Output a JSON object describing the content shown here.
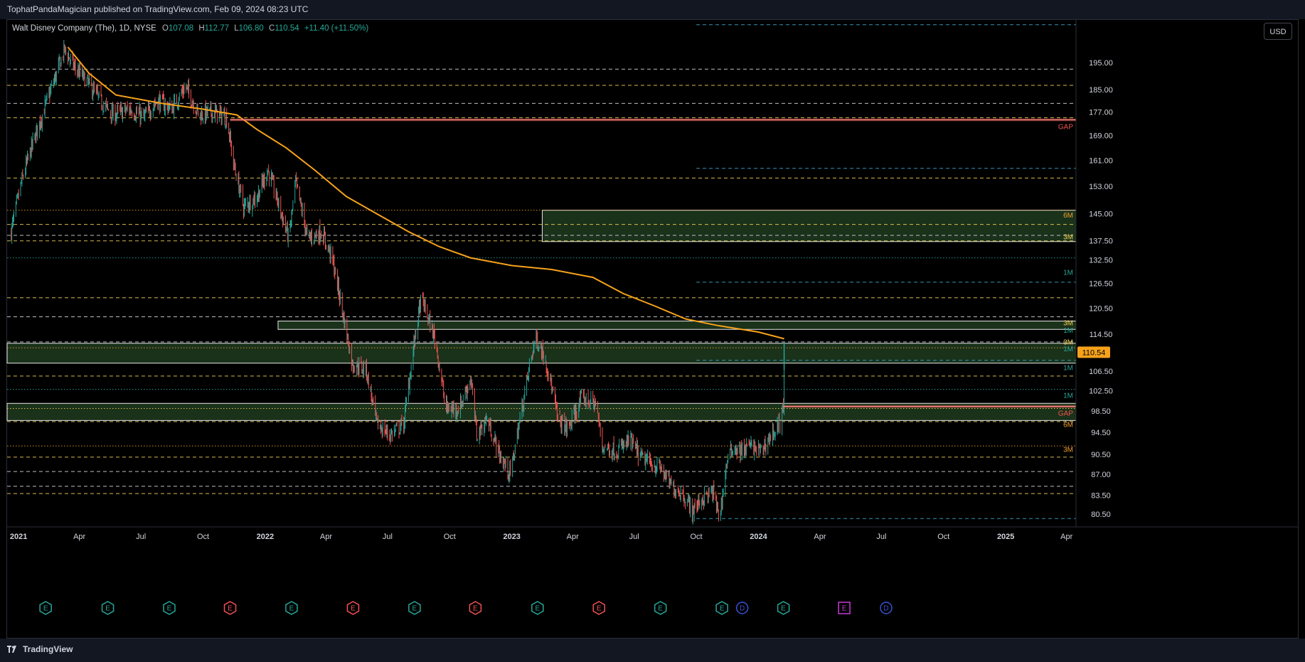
{
  "header": {
    "published": "TophatPandaMagician published on TradingView.com, Feb 09, 2024 08:23 UTC"
  },
  "legend": {
    "symbol": "Walt Disney Company (The), 1D, NYSE",
    "o_label": "O",
    "o_val": "107.08",
    "h_label": "H",
    "h_val": "112.77",
    "l_label": "L",
    "l_val": "106.80",
    "c_label": "C",
    "c_val": "110.54",
    "change": "+11.40 (+11.50%)"
  },
  "currency_button": "USD",
  "footer": {
    "brand": "TradingView"
  },
  "colors": {
    "up": "#26a69a",
    "down": "#ef5350",
    "ma": "#f7a21b",
    "yellow_line": "#f0d050",
    "orange_line": "#f0a030",
    "teal_line": "#26a69a",
    "cyan_line": "#3aa6c8",
    "white_line": "#d1d4dc",
    "red_line": "#ef5350",
    "zone_fill": "#1e3a1e",
    "price_badge": "#f7a21b"
  },
  "chart_data": {
    "type": "candlestick",
    "title": "",
    "y_scale": "log",
    "ylim": [
      78.5,
      212
    ],
    "x_range": [
      "2020-12-15",
      "2025-04-15"
    ],
    "y_ticks": [
      "195.00",
      "185.00",
      "177.00",
      "169.00",
      "161.00",
      "153.00",
      "145.00",
      "137.50",
      "132.50",
      "126.50",
      "120.50",
      "114.50",
      "110.54",
      "106.50",
      "102.50",
      "98.50",
      "94.50",
      "90.50",
      "87.00",
      "83.50",
      "80.50"
    ],
    "x_ticks": [
      {
        "label": "2021",
        "date": "2021-01-01",
        "bold": true
      },
      {
        "label": "Apr",
        "date": "2021-04-01"
      },
      {
        "label": "Jul",
        "date": "2021-07-01"
      },
      {
        "label": "Oct",
        "date": "2021-10-01"
      },
      {
        "label": "2022",
        "date": "2022-01-01",
        "bold": true
      },
      {
        "label": "Apr",
        "date": "2022-04-01"
      },
      {
        "label": "Jul",
        "date": "2022-07-01"
      },
      {
        "label": "Oct",
        "date": "2022-10-01"
      },
      {
        "label": "2023",
        "date": "2023-01-01",
        "bold": true
      },
      {
        "label": "Apr",
        "date": "2023-04-01"
      },
      {
        "label": "Jul",
        "date": "2023-07-01"
      },
      {
        "label": "Oct",
        "date": "2023-10-01"
      },
      {
        "label": "2024",
        "date": "2024-01-01",
        "bold": true
      },
      {
        "label": "Apr",
        "date": "2024-04-01"
      },
      {
        "label": "Jul",
        "date": "2024-07-01"
      },
      {
        "label": "Oct",
        "date": "2024-10-01"
      },
      {
        "label": "2025",
        "date": "2025-01-01",
        "bold": true
      },
      {
        "label": "Apr",
        "date": "2025-04-01"
      }
    ],
    "last_price": 110.54,
    "price_anchors": [
      [
        "2020-12-21",
        140
      ],
      [
        "2021-01-05",
        154
      ],
      [
        "2021-01-20",
        165
      ],
      [
        "2021-02-05",
        176
      ],
      [
        "2021-02-25",
        190
      ],
      [
        "2021-03-10",
        200
      ],
      [
        "2021-03-25",
        193
      ],
      [
        "2021-04-15",
        187
      ],
      [
        "2021-05-05",
        180
      ],
      [
        "2021-05-20",
        176
      ],
      [
        "2021-06-15",
        178
      ],
      [
        "2021-07-05",
        175
      ],
      [
        "2021-07-25",
        181
      ],
      [
        "2021-08-15",
        178
      ],
      [
        "2021-09-05",
        186
      ],
      [
        "2021-09-25",
        176
      ],
      [
        "2021-10-15",
        177
      ],
      [
        "2021-11-05",
        175
      ],
      [
        "2021-11-15",
        160
      ],
      [
        "2021-11-30",
        147
      ],
      [
        "2021-12-20",
        150
      ],
      [
        "2022-01-05",
        158
      ],
      [
        "2022-01-25",
        145
      ],
      [
        "2022-02-05",
        138
      ],
      [
        "2022-02-15",
        154
      ],
      [
        "2022-03-05",
        138
      ],
      [
        "2022-03-25",
        140
      ],
      [
        "2022-04-10",
        133
      ],
      [
        "2022-04-25",
        120
      ],
      [
        "2022-05-10",
        108
      ],
      [
        "2022-05-30",
        107
      ],
      [
        "2022-06-15",
        96
      ],
      [
        "2022-07-05",
        94
      ],
      [
        "2022-07-25",
        96
      ],
      [
        "2022-08-10",
        113
      ],
      [
        "2022-08-20",
        123
      ],
      [
        "2022-09-10",
        113
      ],
      [
        "2022-09-25",
        99
      ],
      [
        "2022-10-15",
        99
      ],
      [
        "2022-11-01",
        105
      ],
      [
        "2022-11-10",
        94
      ],
      [
        "2022-11-25",
        97
      ],
      [
        "2022-12-15",
        90
      ],
      [
        "2022-12-30",
        87
      ],
      [
        "2023-01-20",
        102
      ],
      [
        "2023-02-05",
        114
      ],
      [
        "2023-02-20",
        109
      ],
      [
        "2023-03-10",
        97
      ],
      [
        "2023-03-25",
        95
      ],
      [
        "2023-04-15",
        101
      ],
      [
        "2023-05-05",
        100
      ],
      [
        "2023-05-15",
        92
      ],
      [
        "2023-06-05",
        91
      ],
      [
        "2023-06-25",
        93
      ],
      [
        "2023-07-10",
        90
      ],
      [
        "2023-07-25",
        89
      ],
      [
        "2023-08-10",
        88
      ],
      [
        "2023-08-25",
        85
      ],
      [
        "2023-09-10",
        84
      ],
      [
        "2023-09-25",
        81
      ],
      [
        "2023-10-10",
        83
      ],
      [
        "2023-10-25",
        84
      ],
      [
        "2023-11-05",
        80
      ],
      [
        "2023-11-15",
        89
      ],
      [
        "2023-11-25",
        92
      ],
      [
        "2023-12-05",
        91
      ],
      [
        "2023-12-20",
        92
      ],
      [
        "2024-01-05",
        91
      ],
      [
        "2024-01-20",
        94
      ],
      [
        "2024-02-01",
        96
      ],
      [
        "2024-02-07",
        99
      ],
      [
        "2024-02-08",
        110.5
      ]
    ],
    "moving_average_200": [
      [
        "2021-03-15",
        201
      ],
      [
        "2021-04-15",
        191
      ],
      [
        "2021-05-25",
        183
      ],
      [
        "2021-08-01",
        180
      ],
      [
        "2021-10-01",
        178
      ],
      [
        "2021-11-20",
        176
      ],
      [
        "2021-12-20",
        171
      ],
      [
        "2022-02-01",
        165
      ],
      [
        "2022-03-15",
        158
      ],
      [
        "2022-05-01",
        150
      ],
      [
        "2022-06-15",
        145
      ],
      [
        "2022-08-01",
        140
      ],
      [
        "2022-09-15",
        136
      ],
      [
        "2022-11-01",
        133
      ],
      [
        "2023-01-01",
        131
      ],
      [
        "2023-03-01",
        130
      ],
      [
        "2023-05-01",
        128
      ],
      [
        "2023-06-15",
        124
      ],
      [
        "2023-08-01",
        121
      ],
      [
        "2023-09-15",
        118
      ],
      [
        "2023-11-01",
        116.5
      ],
      [
        "2024-01-01",
        115
      ],
      [
        "2024-02-08",
        113.5
      ]
    ],
    "levels": [
      {
        "price": 192.5,
        "color": "white_line",
        "style": "dash",
        "from": "2020-12-15"
      },
      {
        "price": 186.5,
        "color": "yellow_line",
        "style": "dash",
        "from": "2020-12-15"
      },
      {
        "price": 180.0,
        "color": "white_line",
        "style": "dash",
        "from": "2020-12-15"
      },
      {
        "price": 175.0,
        "color": "yellow_line",
        "style": "dash",
        "from": "2020-12-15"
      },
      {
        "price": 155.5,
        "color": "yellow_line",
        "style": "dash",
        "from": "2020-12-15"
      },
      {
        "price": 146.0,
        "color": "orange_line",
        "style": "dot",
        "from": "2020-12-15"
      },
      {
        "price": 142.0,
        "color": "yellow_line",
        "style": "dash",
        "from": "2020-12-15"
      },
      {
        "price": 139.0,
        "color": "white_line",
        "style": "dash",
        "from": "2020-12-15"
      },
      {
        "price": 137.5,
        "color": "yellow_line",
        "style": "dash",
        "from": "2020-12-15"
      },
      {
        "price": 133.0,
        "color": "teal_line",
        "style": "dot",
        "from": "2020-12-15"
      },
      {
        "price": 123.0,
        "color": "yellow_line",
        "style": "dash",
        "from": "2020-12-15"
      },
      {
        "price": 118.5,
        "color": "white_line",
        "style": "dash",
        "from": "2020-12-15"
      },
      {
        "price": 112.8,
        "color": "white_line",
        "style": "dash",
        "from": "2020-12-15"
      },
      {
        "price": 111.5,
        "color": "orange_line",
        "style": "dot",
        "from": "2020-12-15"
      },
      {
        "price": 105.5,
        "color": "yellow_line",
        "style": "dash",
        "from": "2020-12-15"
      },
      {
        "price": 102.8,
        "color": "teal_line",
        "style": "dot",
        "from": "2020-12-15"
      },
      {
        "price": 99.0,
        "color": "yellow_line",
        "style": "dot",
        "from": "2020-12-15"
      },
      {
        "price": 96.5,
        "color": "yellow_line",
        "style": "dash",
        "from": "2020-12-15"
      },
      {
        "price": 92.0,
        "color": "orange_line",
        "style": "dot",
        "from": "2020-12-15"
      },
      {
        "price": 90.0,
        "color": "yellow_line",
        "style": "dash",
        "from": "2020-12-15"
      },
      {
        "price": 87.5,
        "color": "white_line",
        "style": "dash",
        "from": "2020-12-15"
      },
      {
        "price": 85.0,
        "color": "white_line",
        "style": "dash",
        "from": "2020-12-15"
      },
      {
        "price": 83.8,
        "color": "yellow_line",
        "style": "dash",
        "from": "2020-12-15"
      },
      {
        "price": 210.0,
        "color": "cyan_line",
        "style": "dash",
        "from": "2023-10-01"
      },
      {
        "price": 158.5,
        "color": "cyan_line",
        "style": "dash",
        "from": "2023-10-01"
      },
      {
        "price": 126.8,
        "color": "cyan_line",
        "style": "dash",
        "from": "2023-10-01"
      },
      {
        "price": 108.8,
        "color": "cyan_line",
        "style": "dash",
        "from": "2023-10-01"
      },
      {
        "price": 79.8,
        "color": "cyan_line",
        "style": "dash",
        "from": "2023-10-01"
      }
    ],
    "zones": [
      {
        "top": 146.0,
        "bottom": 137.3,
        "from": "2023-02-15"
      },
      {
        "top": 117.5,
        "bottom": 115.6,
        "from": "2022-01-20"
      },
      {
        "top": 112.5,
        "bottom": 108.2,
        "from": "2020-12-15"
      },
      {
        "top": 100.0,
        "bottom": 96.7,
        "from": "2020-12-15"
      }
    ],
    "gaps": [
      {
        "price": 174.3,
        "from": "2021-11-10",
        "label": "GAP"
      },
      {
        "price": 99.4,
        "from": "2024-02-07",
        "label": "GAP"
      }
    ],
    "level_labels": [
      {
        "text": "6M",
        "price": 144.5,
        "color": "orange_line"
      },
      {
        "text": "3M",
        "price": 138.5,
        "color": "yellow_line"
      },
      {
        "text": "1M",
        "price": 129.2,
        "color": "teal_line"
      },
      {
        "text": "3M",
        "price": 117.0,
        "color": "yellow_line"
      },
      {
        "text": "1M",
        "price": 115.3,
        "color": "teal_line"
      },
      {
        "text": "3M",
        "price": 112.7,
        "color": "yellow_line"
      },
      {
        "text": "1M",
        "price": 111.2,
        "color": "teal_line"
      },
      {
        "text": "1M",
        "price": 107.2,
        "color": "teal_line"
      },
      {
        "text": "1M",
        "price": 101.5,
        "color": "teal_line"
      },
      {
        "text": "6M",
        "price": 95.9,
        "color": "orange_line"
      },
      {
        "text": "3M",
        "price": 91.3,
        "color": "orange_line"
      }
    ],
    "events": [
      {
        "date": "2021-02-10",
        "type": "E",
        "color": "up"
      },
      {
        "date": "2021-05-13",
        "type": "E",
        "color": "up"
      },
      {
        "date": "2021-08-12",
        "type": "E",
        "color": "up"
      },
      {
        "date": "2021-11-10",
        "type": "E",
        "color": "down"
      },
      {
        "date": "2022-02-09",
        "type": "E",
        "color": "up"
      },
      {
        "date": "2022-05-11",
        "type": "E",
        "color": "down"
      },
      {
        "date": "2022-08-10",
        "type": "E",
        "color": "up"
      },
      {
        "date": "2022-11-08",
        "type": "E",
        "color": "down"
      },
      {
        "date": "2023-02-08",
        "type": "E",
        "color": "up"
      },
      {
        "date": "2023-05-10",
        "type": "E",
        "color": "down"
      },
      {
        "date": "2023-08-09",
        "type": "E",
        "color": "up"
      },
      {
        "date": "2023-11-08",
        "type": "E",
        "color": "up"
      },
      {
        "date": "2023-12-08",
        "type": "D",
        "color": "blue"
      },
      {
        "date": "2024-02-07",
        "type": "E",
        "color": "up"
      },
      {
        "date": "2024-05-07",
        "type": "E",
        "color": "magenta"
      },
      {
        "date": "2024-07-08",
        "type": "D",
        "color": "blue"
      }
    ]
  }
}
